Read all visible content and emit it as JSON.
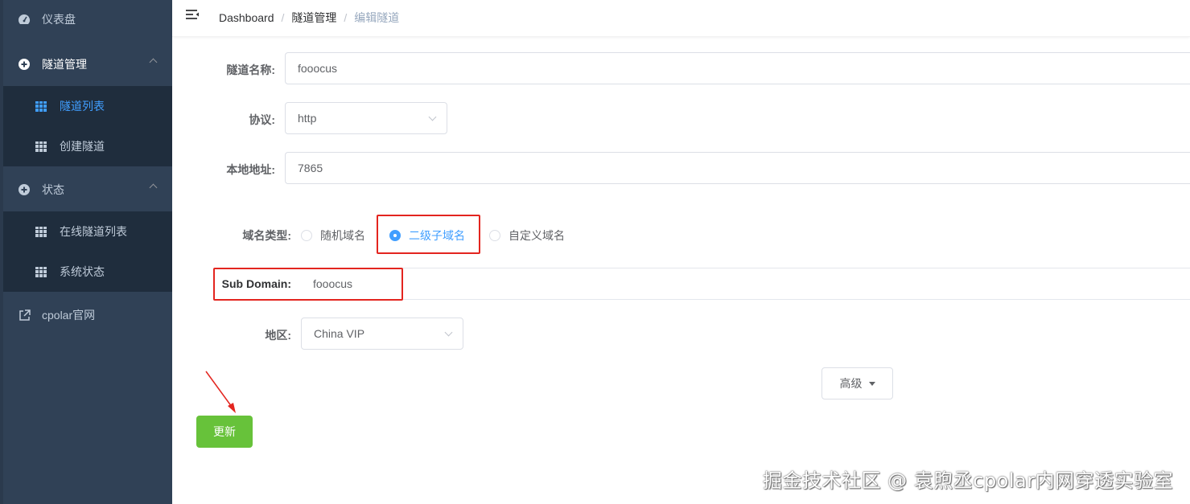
{
  "sidebar": {
    "dashboard": "仪表盘",
    "tunnel_mgmt": "隧道管理",
    "tunnel_list": "隧道列表",
    "create_tunnel": "创建隧道",
    "status": "状态",
    "online_tunnels": "在线隧道列表",
    "system_status": "系统状态",
    "cpolar_site": "cpolar官网"
  },
  "breadcrumb": {
    "items": [
      "Dashboard",
      "隧道管理",
      "编辑隧道"
    ],
    "separator": "/"
  },
  "form": {
    "name_label": "隧道名称:",
    "name_value": "fooocus",
    "protocol_label": "协议:",
    "protocol_value": "http",
    "local_addr_label": "本地地址:",
    "local_addr_value": "7865",
    "domain_type_label": "域名类型:",
    "domain_type_options": [
      "随机域名",
      "二级子域名",
      "自定义域名"
    ],
    "domain_type_selected": "二级子域名",
    "subdomain_label": "Sub Domain:",
    "subdomain_value": "fooocus",
    "region_label": "地区:",
    "region_value": "China VIP",
    "advanced_button": "高级",
    "update_button": "更新"
  },
  "watermark": "掘金技术社区 @ 袁煦丞cpolar内网穿透实验室",
  "colors": {
    "sidebar_bg": "#304156",
    "submenu_bg": "#1f2d3d",
    "active": "#409eff",
    "update_btn": "#67c23a",
    "annotation_red": "#e3251f"
  }
}
